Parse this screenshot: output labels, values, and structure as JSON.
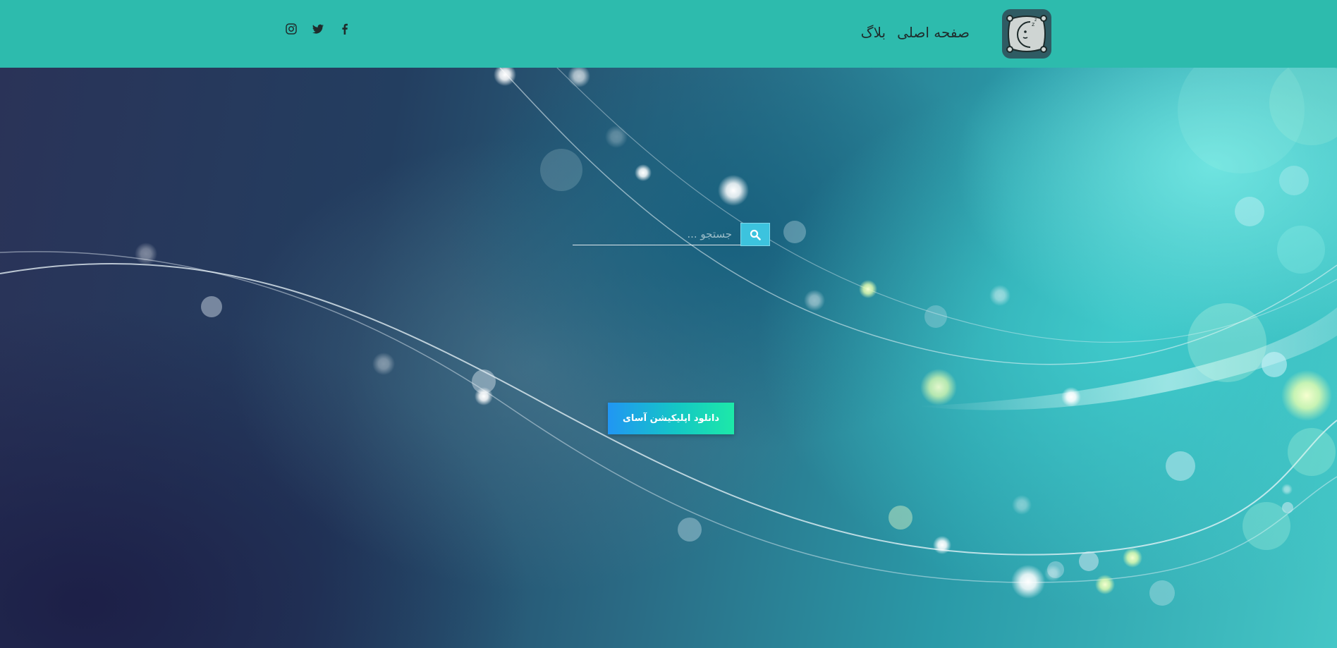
{
  "header": {
    "background": "#2dbbad",
    "logo_icon": "pillow-moon-logo-icon",
    "nav": [
      {
        "label": "صفحه اصلی"
      },
      {
        "label": "بلاگ"
      }
    ],
    "social": [
      {
        "icon": "facebook-icon"
      },
      {
        "icon": "twitter-icon"
      },
      {
        "icon": "instagram-icon"
      }
    ]
  },
  "hero": {
    "search": {
      "placeholder": "جستجو ...",
      "value": "",
      "button_icon": "search-icon",
      "button_color": "#3cc3de"
    },
    "download_label": "دانلود اپلیکیشن آسای",
    "download_gradient": [
      "#2196f3",
      "#1de9a8"
    ]
  }
}
